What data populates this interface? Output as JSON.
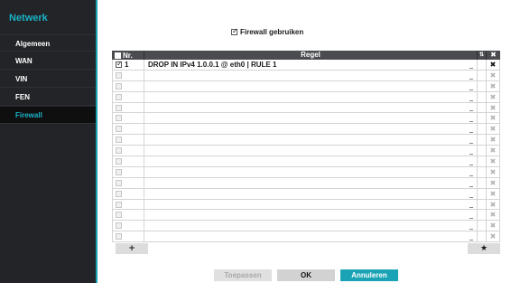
{
  "sidebar": {
    "title": "Netwerk",
    "items": [
      {
        "label": "Algemeen"
      },
      {
        "label": "WAN"
      },
      {
        "label": "VIN"
      },
      {
        "label": "FEN"
      },
      {
        "label": "Firewall"
      }
    ]
  },
  "firewall_enable": {
    "label": "Firewall gebruiken",
    "checked": true
  },
  "table": {
    "columns": {
      "nr": "Nr.",
      "rule": "Regel",
      "sort": "⇅",
      "delete": "✖"
    },
    "rows": [
      {
        "nr": "1",
        "checked": true,
        "rule": "DROP IN IPv4 1.0.0.1 @ eth0  | RULE 1"
      },
      {
        "nr": "",
        "checked": false,
        "rule": ""
      },
      {
        "nr": "",
        "checked": false,
        "rule": ""
      },
      {
        "nr": "",
        "checked": false,
        "rule": ""
      },
      {
        "nr": "",
        "checked": false,
        "rule": ""
      },
      {
        "nr": "",
        "checked": false,
        "rule": ""
      },
      {
        "nr": "",
        "checked": false,
        "rule": ""
      },
      {
        "nr": "",
        "checked": false,
        "rule": ""
      },
      {
        "nr": "",
        "checked": false,
        "rule": ""
      },
      {
        "nr": "",
        "checked": false,
        "rule": ""
      },
      {
        "nr": "",
        "checked": false,
        "rule": ""
      },
      {
        "nr": "",
        "checked": false,
        "rule": ""
      },
      {
        "nr": "",
        "checked": false,
        "rule": ""
      },
      {
        "nr": "",
        "checked": false,
        "rule": ""
      },
      {
        "nr": "",
        "checked": false,
        "rule": ""
      },
      {
        "nr": "",
        "checked": false,
        "rule": ""
      },
      {
        "nr": "",
        "checked": false,
        "rule": ""
      }
    ]
  },
  "actions": {
    "add": "+",
    "star": "★"
  },
  "footer": {
    "apply": "Toepassen",
    "ok": "OK",
    "cancel": "Annuleren"
  },
  "colors": {
    "accent": "#1aa3b5",
    "sidebar_bg": "#222427",
    "header_bg": "#4a4c50"
  },
  "icons": {
    "delete": "close-x-icon",
    "sort": "sort-icon",
    "star": "star-icon",
    "add": "plus-icon"
  }
}
